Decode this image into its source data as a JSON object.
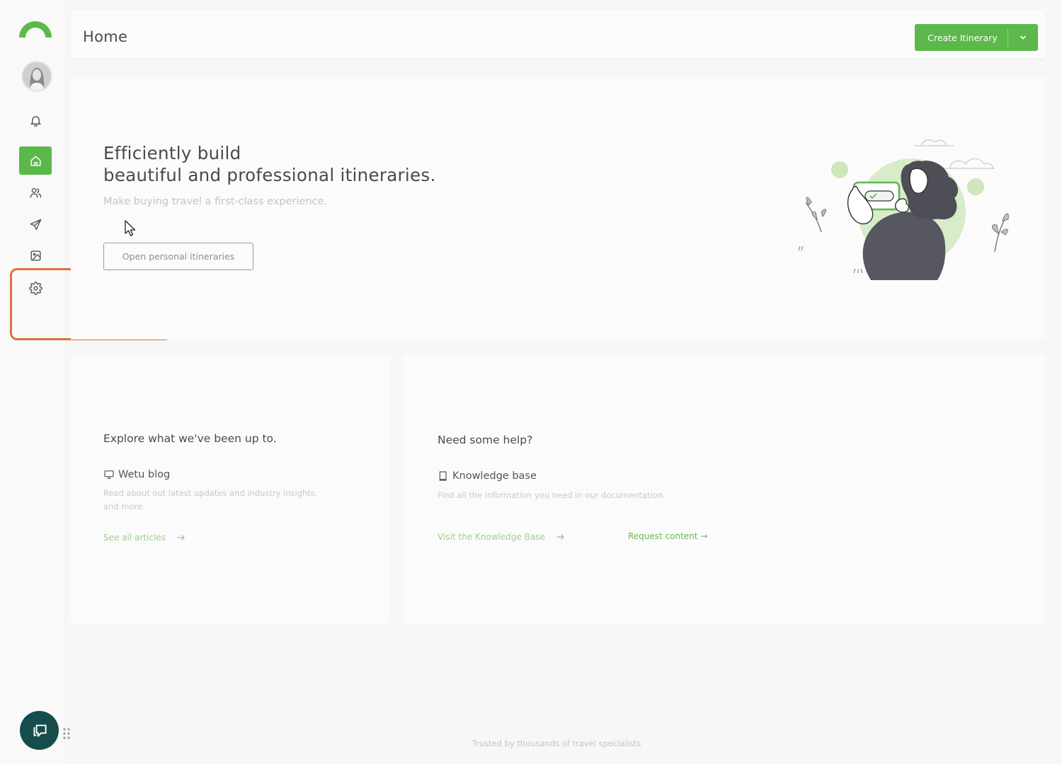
{
  "colors": {
    "brand_green": "#5cb84a",
    "link_green": "#9fcf8d",
    "chat_button": "#174c4c",
    "highlight_border": "#d9733e"
  },
  "sidebar": {
    "logo_icon": "wetu-arc-logo",
    "items": [
      {
        "icon": "bell-icon",
        "name": "notifications"
      },
      {
        "icon": "home-icon",
        "name": "home",
        "active": true
      },
      {
        "icon": "users-icon",
        "name": "contacts"
      },
      {
        "icon": "send-icon",
        "name": "send"
      },
      {
        "icon": "image-icon",
        "name": "media"
      },
      {
        "icon": "gear-icon",
        "name": "settings"
      }
    ]
  },
  "header": {
    "title": "Home",
    "create_button_label": "Create Itinerary"
  },
  "hero": {
    "title_line1": "Efficiently build",
    "title_line2": "beautiful and professional itineraries.",
    "subtitle": "Make buying travel a first-class experience.",
    "button_label": "Open personal itineraries"
  },
  "blog_card": {
    "heading": "Explore what we've been up to.",
    "item_title": "Wetu blog",
    "item_icon": "monitor-icon",
    "description_line1": "Read about out latest updates and industry insights,",
    "description_line2": "and more.",
    "link_label": "See all articles"
  },
  "help_card": {
    "heading": "Need some help?",
    "item_title": "Knowledge base",
    "item_icon": "book-icon",
    "description": "Find all the information you need in our documentation.",
    "link_knowledge": "Visit the Knowledge Base",
    "link_request": "Request content →"
  },
  "footer": {
    "note": "Trusted by thousands of travel specialists",
    "chat_icon": "chat-bubble-icon"
  }
}
